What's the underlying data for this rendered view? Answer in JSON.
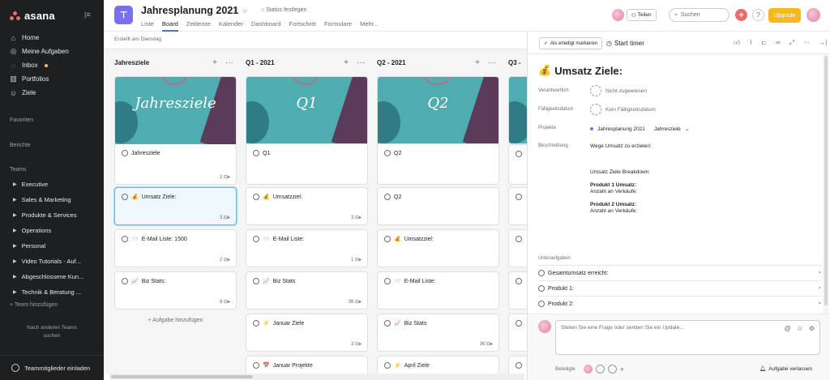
{
  "sidebar": {
    "logo": "asana",
    "nav": [
      {
        "label": "Home",
        "icon": "home-icon"
      },
      {
        "label": "Meine Aufgaben",
        "icon": "check-circle-icon"
      },
      {
        "label": "Inbox",
        "icon": "bell-icon"
      },
      {
        "label": "Portfolios",
        "icon": "chart-icon"
      },
      {
        "label": "Ziele",
        "icon": "person-icon"
      }
    ],
    "sections": {
      "favorites": "Favoriten",
      "reports": "Berichte",
      "teams": "Teams"
    },
    "teams": [
      "Executive",
      "Sales & Marketing",
      "Produkte & Services",
      "Operations",
      "Personal",
      "Video Tutorials - Auf...",
      "Abgeschlossene Kun...",
      "Technik & Beratung ..."
    ],
    "add_team": "+ Team hinzufügen",
    "browse_line1": "Nach anderen Teams",
    "browse_line2": "suchen",
    "invite": "Teammitglieder einladen"
  },
  "header": {
    "project_title": "Jahresplanung 2021",
    "status": "Status festlegen",
    "tabs": [
      "Liste",
      "Board",
      "Zeitleiste",
      "Kalender",
      "Dashboard",
      "Fortschritt",
      "Formulare",
      "Mehr..."
    ],
    "share": "Teilen",
    "search": "Suchen",
    "upgrade": "Upgrade",
    "accent": "#4573d2"
  },
  "subheader": "Erstellt am Dienstag",
  "board": {
    "columns": [
      {
        "title": "Jahresziele",
        "cover": "Jahresziele",
        "cards": [
          {
            "title": "Jahresziele",
            "meta": "2",
            "emoji": ""
          },
          {
            "title": "Umsatz Ziele:",
            "meta": "3",
            "emoji": "💰"
          },
          {
            "title": "E-Mail Liste: 1500",
            "meta": "2",
            "emoji": "📨"
          },
          {
            "title": "Biz Stats:",
            "meta": "8",
            "emoji": "📈"
          }
        ],
        "add": "+ Aufgabe hinzufügen"
      },
      {
        "title": "Q1 - 2021",
        "cover": "Q1",
        "cards": [
          {
            "title": "Q1",
            "meta": "",
            "emoji": ""
          },
          {
            "title": "Umsatzziel:",
            "meta": "3",
            "emoji": "💰"
          },
          {
            "title": "E-Mail Liste:",
            "meta": "1",
            "emoji": "📨"
          },
          {
            "title": "Biz Stats",
            "meta": "36",
            "emoji": "📈"
          },
          {
            "title": "Januar Ziele",
            "meta": "3",
            "emoji": "⚡"
          },
          {
            "title": "Januar Projekte",
            "meta": "",
            "emoji": "📅"
          }
        ]
      },
      {
        "title": "Q2 - 2021",
        "cover": "Q2",
        "cards": [
          {
            "title": "Q2",
            "meta": "",
            "emoji": ""
          },
          {
            "title": "Q2",
            "meta": "",
            "emoji": ""
          },
          {
            "title": "Umsatzziel:",
            "meta": "",
            "emoji": "💰"
          },
          {
            "title": "E-Mail Liste:",
            "meta": "",
            "emoji": "📨"
          },
          {
            "title": "Biz Stats",
            "meta": "36",
            "emoji": "📈"
          },
          {
            "title": "April Ziele",
            "meta": "",
            "emoji": "⚡"
          }
        ]
      },
      {
        "title": "Q3 -",
        "cover": "",
        "cards": []
      }
    ]
  },
  "task": {
    "mark_done": "Als erledigt markieren",
    "timer": "Start timer",
    "title": "Umsatz Ziele:",
    "emoji": "💰",
    "labels": {
      "assignee": "Verantwortlich",
      "due": "Fälligkeitsdatum",
      "projects": "Projekte",
      "description": "Beschreibung",
      "subtasks": "Unteraufgaben"
    },
    "assignee": "Nicht zugewiesen",
    "due": "Kein Fälligkeitsdatum",
    "project": "Jahresplanung 2021",
    "section": "Jahresziele",
    "description": {
      "line1": "Wege Umsatz zu erzielen:",
      "line2": "Umsatz Ziele Breakdown:",
      "p1": "Produkt 1 Umsatz:",
      "p1_sub": "Anzahl an Verkäufe:",
      "p2": "Produkt 2 Umsatz:",
      "p2_sub": "Anzahl an Verkäufe:"
    },
    "subtasks": [
      "Gesamtumsatz erreicht:",
      "Produkt 1:",
      "Produkt 2:"
    ],
    "comment_placeholder": "Stellen Sie eine Frage oder senden Sie ein Update...",
    "followers": "Beteiligte",
    "leave": "Aufgabe verlassen"
  }
}
